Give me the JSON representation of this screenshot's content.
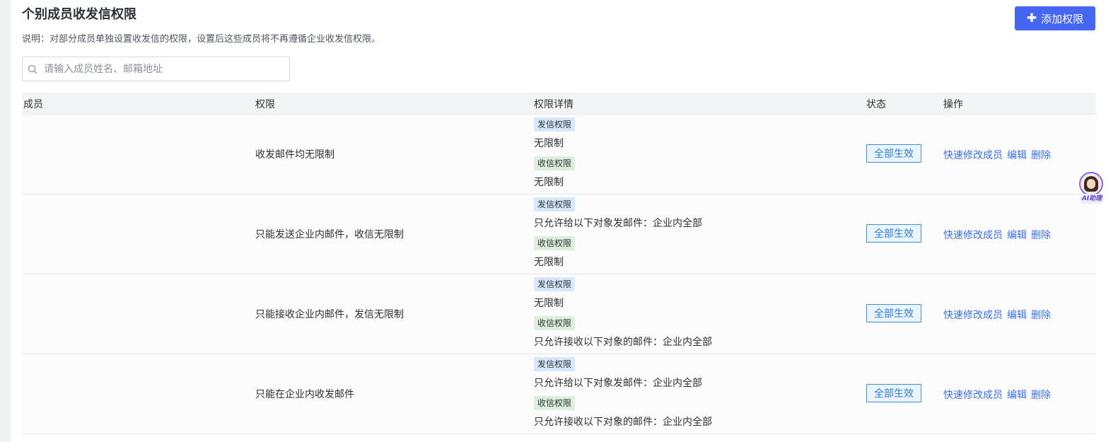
{
  "header": {
    "title": "个别成员收发信权限",
    "description": "说明：对部分成员单独设置收发信的权限，设置后这些成员将不再遵循企业收发信权限。",
    "add_button_label": "添加权限"
  },
  "search": {
    "placeholder": "请输入成员姓名、邮箱地址",
    "value": ""
  },
  "table": {
    "columns": [
      "成员",
      "权限",
      "权限详情",
      "状态",
      "操作"
    ],
    "rows": [
      {
        "member": "",
        "permission": "收发邮件均无限制",
        "send_tag": "发信权限",
        "send_detail": "无限制",
        "recv_tag": "收信权限",
        "recv_detail": "无限制",
        "status": "全部生效",
        "ops": [
          "快速修改成员",
          "编辑",
          "删除"
        ]
      },
      {
        "member": "",
        "permission": "只能发送企业内邮件，收信无限制",
        "send_tag": "发信权限",
        "send_detail": "只允许给以下对象发邮件：企业内全部",
        "recv_tag": "收信权限",
        "recv_detail": "无限制",
        "status": "全部生效",
        "ops": [
          "快速修改成员",
          "编辑",
          "删除"
        ]
      },
      {
        "member": "",
        "permission": "只能接收企业内邮件，发信无限制",
        "send_tag": "发信权限",
        "send_detail": "无限制",
        "recv_tag": "收信权限",
        "recv_detail": "只允许接收以下对象的邮件：企业内全部",
        "status": "全部生效",
        "ops": [
          "快速修改成员",
          "编辑",
          "删除"
        ]
      },
      {
        "member": "",
        "permission": "只能在企业内收发邮件",
        "send_tag": "发信权限",
        "send_detail": "只允许给以下对象发邮件：企业内全部",
        "recv_tag": "收信权限",
        "recv_detail": "只允许接收以下对象的邮件：企业内全部",
        "status": "全部生效",
        "ops": [
          "快速修改成员",
          "编辑",
          "删除"
        ]
      }
    ]
  },
  "ai_helper": {
    "label": "AI助理"
  },
  "colors": {
    "primary": "#4466f2",
    "link": "#3b6ff0",
    "status_border": "#3e8fe0",
    "send_tag_bg": "#d6e8fb",
    "recv_tag_bg": "#dcefdc"
  },
  "icons": {
    "search": "search-icon",
    "add": "plus-icon"
  }
}
